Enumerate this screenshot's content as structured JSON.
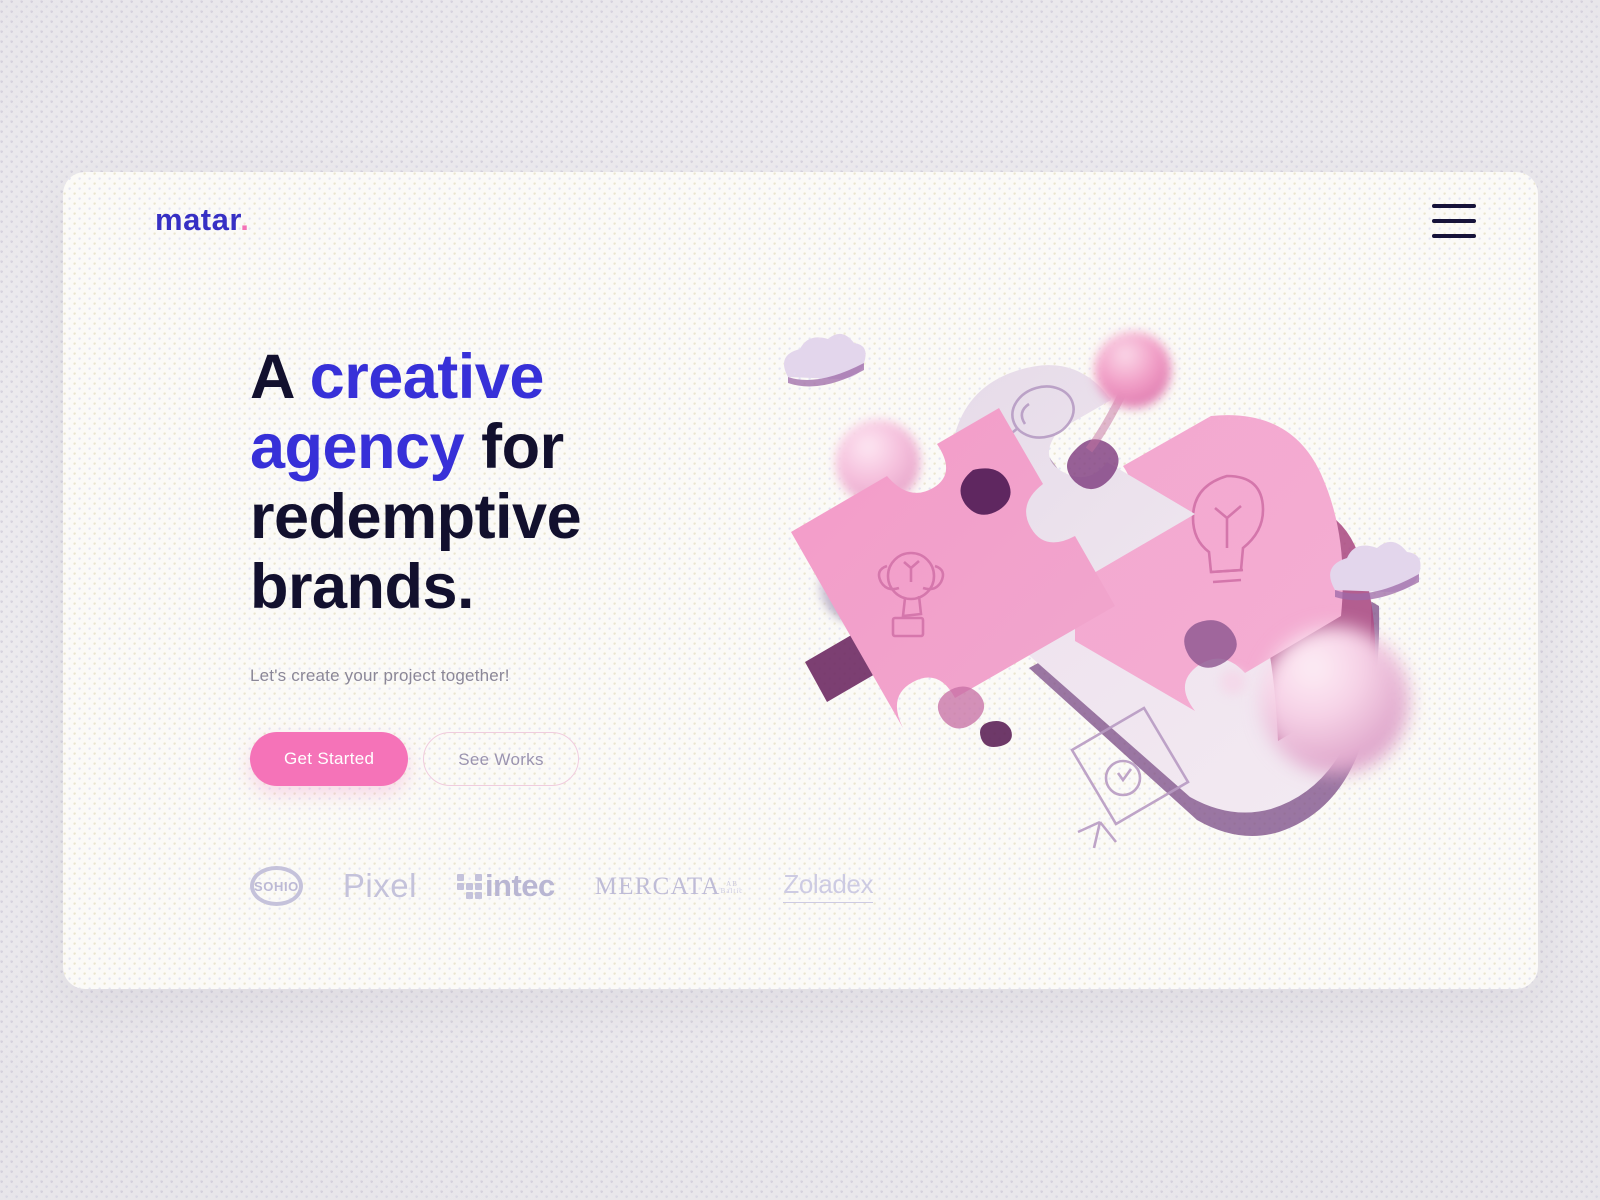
{
  "brand": {
    "name": "matar",
    "dot": "."
  },
  "nav": {
    "menu_icon": "hamburger-menu-icon"
  },
  "hero": {
    "headline_part1": "A ",
    "headline_accent1": "creative",
    "headline_space": " ",
    "headline_accent2": "agency",
    "headline_part2": " for",
    "headline_line3": "redemptive",
    "headline_line4": "brands.",
    "subhead": "Let's create your project together!",
    "primary_cta": "Get Started",
    "secondary_cta": "See Works"
  },
  "logos": [
    {
      "name": "SOHIO"
    },
    {
      "name": "Pixel"
    },
    {
      "name": "intec"
    },
    {
      "name": "MERCATA",
      "sub": "AB Baltic"
    },
    {
      "name": "Zoladex"
    }
  ],
  "illustration": {
    "alt": "3D pink jigsaw puzzle pieces with creative icons",
    "icons": [
      "magnifier-icon",
      "lightbulb-icon",
      "easel-icon",
      "trophy-icon"
    ]
  },
  "colors": {
    "brand_blue": "#3730c4",
    "accent_blue": "#3730d8",
    "pink": "#f573b8",
    "headline_dark": "#12102e",
    "muted": "#8b8798",
    "card_bg": "#fbfaf7",
    "page_bg": "#eceaee",
    "logo_gray": "#b9b6d4"
  }
}
